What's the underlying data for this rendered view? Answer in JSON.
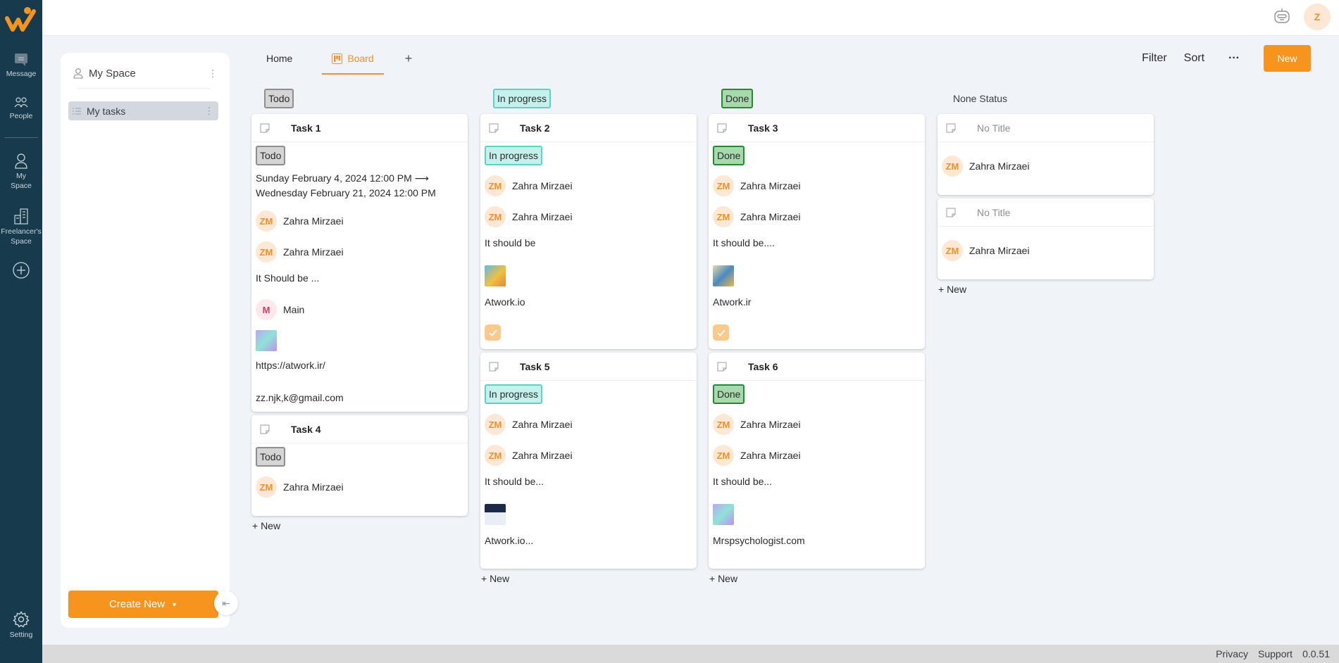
{
  "rail": {
    "items": [
      {
        "label": "Message",
        "icon": "message-icon"
      },
      {
        "label": "People",
        "icon": "people-icon"
      },
      {
        "label": "My Space",
        "icon": "user-icon"
      },
      {
        "label": "Freelancer's Space",
        "icon": "building-icon"
      },
      {
        "label": "",
        "icon": "add-circle-icon"
      }
    ],
    "setting_label": "Setting"
  },
  "topbar": {
    "avatar_initial": "Z"
  },
  "panel": {
    "header": "My Space",
    "items": [
      {
        "label": "My tasks"
      }
    ],
    "create_label": "Create New"
  },
  "tabs": [
    {
      "label": "Home",
      "active": false
    },
    {
      "label": "Board",
      "active": true
    },
    {
      "label": "+",
      "active": false
    }
  ],
  "toolbar": {
    "filter": "Filter",
    "sort": "Sort",
    "more": "···",
    "new": "New"
  },
  "board": {
    "add_label": "+ New",
    "columns": [
      {
        "title": "Todo",
        "style": "todo",
        "cards": [
          {
            "title": "Task 1",
            "status": "Todo",
            "dates": "Sunday February 4, 2024 12:00 PM ⟶ Wednesday February 21, 2024 12:00 PM",
            "people": [
              "Zahra Mirzaei",
              "Zahra Mirzaei"
            ],
            "text": "It Should be ...",
            "tag": "Main",
            "url": "https://atwork.ir/",
            "email": "zz.njk,k@gmail.com"
          },
          {
            "title": "Task 4",
            "status": "Todo",
            "people": [
              "Zahra Mirzaei"
            ]
          }
        ]
      },
      {
        "title": "In progress",
        "style": "prog",
        "cards": [
          {
            "title": "Task 2",
            "status": "In progress",
            "people": [
              "Zahra Mirzaei",
              "Zahra Mirzaei"
            ],
            "text": "It should be",
            "link": "Atwork.io",
            "checked": true
          },
          {
            "title": "Task 5",
            "status": "In progress",
            "people": [
              "Zahra Mirzaei",
              "Zahra Mirzaei"
            ],
            "text": "It should be...",
            "link": "Atwork.io..."
          }
        ]
      },
      {
        "title": "Done",
        "style": "done",
        "cards": [
          {
            "title": "Task 3",
            "status": "Done",
            "people": [
              "Zahra Mirzaei",
              "Zahra Mirzaei"
            ],
            "text": "It should be....",
            "link": "Atwork.ir",
            "checked": true
          },
          {
            "title": "Task 6",
            "status": "Done",
            "people": [
              "Zahra Mirzaei",
              "Zahra Mirzaei"
            ],
            "text": "It should be...",
            "link": "Mrspsychologist.com"
          }
        ]
      },
      {
        "title": "None Status",
        "style": "none",
        "cards": [
          {
            "title": "No Title",
            "people": [
              "Zahra Mirzaei"
            ]
          },
          {
            "title": "No Title",
            "people": [
              "Zahra Mirzaei"
            ]
          }
        ]
      }
    ]
  },
  "footer": {
    "privacy": "Privacy",
    "support": "Support",
    "version": "0.0.51"
  },
  "colors": {
    "accent": "#f7941d",
    "rail": "#173a4d"
  }
}
